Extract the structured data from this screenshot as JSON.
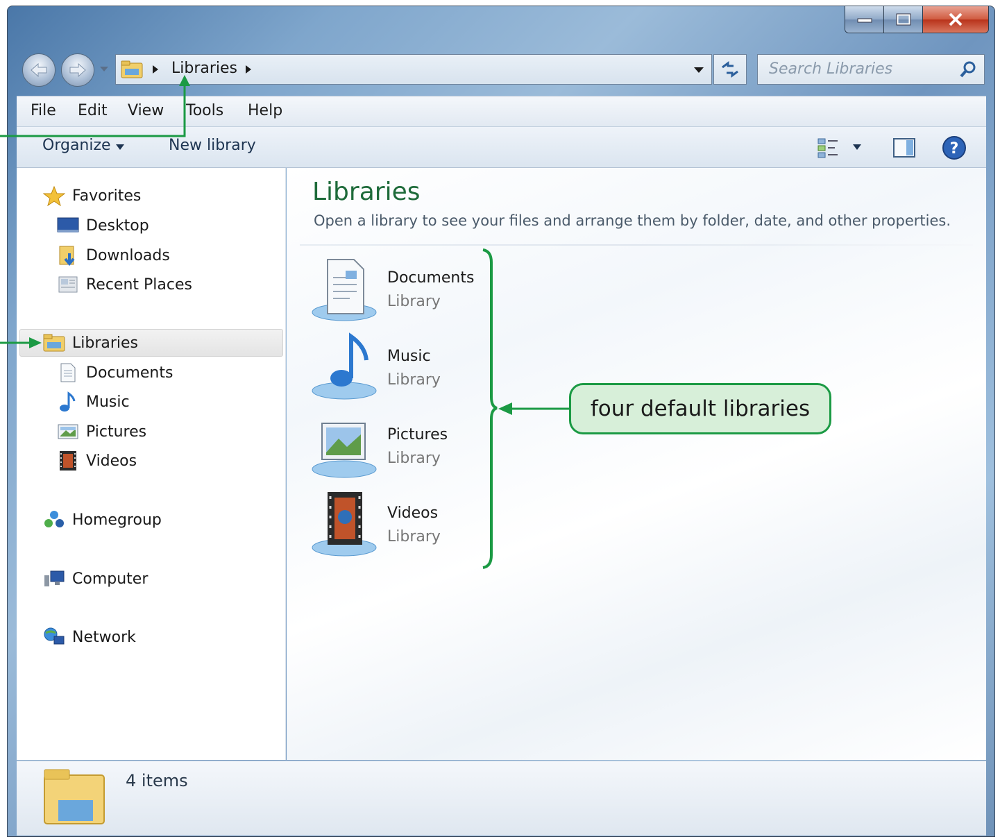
{
  "window": {
    "minimize_icon": "minimize-icon",
    "maximize_icon": "maximize-icon",
    "close_icon": "close-icon"
  },
  "address": {
    "crumb": "Libraries",
    "search_placeholder": "Search Libraries"
  },
  "menu": {
    "items": [
      "File",
      "Edit",
      "View",
      "Tools",
      "Help"
    ]
  },
  "toolbar": {
    "organize": "Organize",
    "new_library": "New library"
  },
  "nav": {
    "favorites": "Favorites",
    "desktop": "Desktop",
    "downloads": "Downloads",
    "recent_places": "Recent Places",
    "libraries": "Libraries",
    "documents": "Documents",
    "music": "Music",
    "pictures": "Pictures",
    "videos": "Videos",
    "homegroup": "Homegroup",
    "computer": "Computer",
    "network": "Network"
  },
  "content": {
    "title": "Libraries",
    "description": "Open a library to see your files and arrange them by folder, date, and other properties.",
    "libraries": [
      {
        "name": "Documents",
        "type": "Library"
      },
      {
        "name": "Music",
        "type": "Library"
      },
      {
        "name": "Pictures",
        "type": "Library"
      },
      {
        "name": "Videos",
        "type": "Library"
      }
    ]
  },
  "status": {
    "item_count": "4 items"
  },
  "annotation": {
    "callout": "four default libraries",
    "color": "#1b9a44"
  }
}
